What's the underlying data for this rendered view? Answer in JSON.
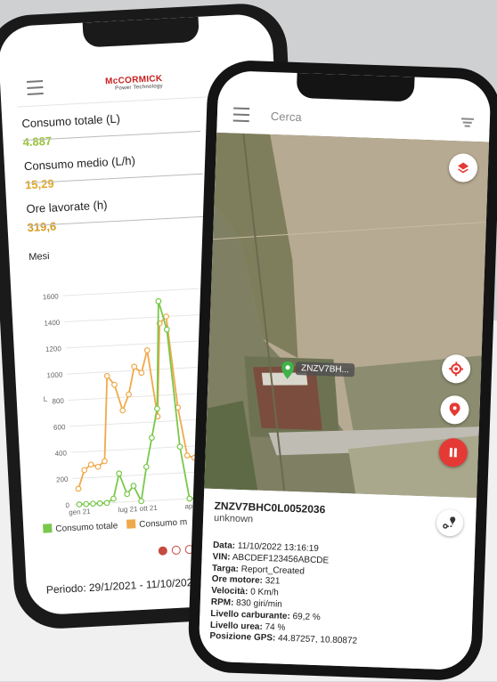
{
  "phone1": {
    "brand": "McCORMICK",
    "brand_tagline": "Power Technology",
    "stats": [
      {
        "label": "Consumo totale (L)",
        "value": "4.887",
        "color": "#9bc33a"
      },
      {
        "label": "Consumo medio (L/h)",
        "value": "15,29",
        "color": "#e0a92b"
      },
      {
        "label": "Ore lavorate (h)",
        "value": "319,6",
        "color": "#d49a22"
      }
    ],
    "chart_title": "Mesi",
    "legend": [
      "Consumo totale",
      "Consumo m"
    ],
    "period": "Periodo: 29/1/2021 - 11/10/2022"
  },
  "chart_data": {
    "type": "line",
    "title": "Mesi",
    "ylabel": "L",
    "ylim": [
      0,
      1600
    ],
    "yticks": [
      "1600",
      "1400",
      "1200",
      "1000",
      "800",
      "600",
      "400",
      "200",
      "0"
    ],
    "xticks": [
      "gen 21",
      "lug 21",
      "ott 21",
      "apr"
    ],
    "grid": true,
    "series": [
      {
        "name": "Consumo totale",
        "color": "#79c84b",
        "values": [
          0,
          0,
          0,
          0,
          0,
          30,
          220,
          60,
          120,
          0,
          260,
          480,
          700,
          1520,
          1300,
          400,
          0,
          0,
          60,
          20,
          80
        ]
      },
      {
        "name": "Consumo m",
        "color": "#f0a94a",
        "values": [
          120,
          260,
          300,
          280,
          320,
          970,
          900,
          700,
          820,
          1030,
          980,
          1150,
          640,
          1350,
          1400,
          700,
          330,
          310,
          300,
          380,
          650
        ]
      }
    ]
  },
  "phone2": {
    "search_placeholder": "Cerca",
    "marker_label": "ZNZV7BH...",
    "vin_title": "ZNZV7BHC0L0052036",
    "vin_sub": "unknown",
    "details": [
      {
        "label": "Data:",
        "value": "11/10/2022 13:16:19"
      },
      {
        "label": "VIN:",
        "value": "ABCDEF123456ABCDE"
      },
      {
        "label": "Targa:",
        "value": "Report_Created"
      },
      {
        "label": "Ore motore:",
        "value": "321"
      },
      {
        "label": "Velocità:",
        "value": "0 Km/h"
      },
      {
        "label": "RPM:",
        "value": "830 giri/min"
      },
      {
        "label": "Livello carburante:",
        "value": "69,2 %"
      },
      {
        "label": "Livello urea:",
        "value": "74 %"
      },
      {
        "label": "Posizione GPS:",
        "value": "44.87257, 10.80872"
      }
    ]
  }
}
